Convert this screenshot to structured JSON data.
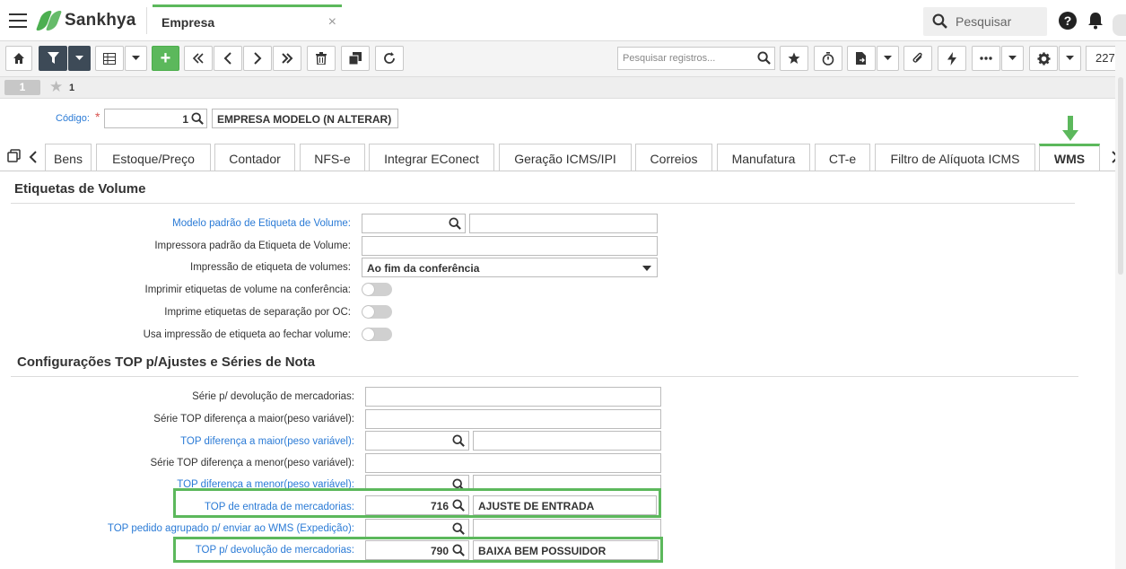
{
  "header": {
    "brand": "Sankhya",
    "app_tab": "Empresa",
    "app_tab_close": "×",
    "search_label": "Pesquisar",
    "help_glyph": "?"
  },
  "toolbar": {
    "search_placeholder": "Pesquisar registros...",
    "record_count": "227",
    "add_glyph": "+"
  },
  "record_nav": {
    "current": "1",
    "favorites_count": "1"
  },
  "record": {
    "codigo_label": "Código:",
    "required_mark": "*",
    "codigo_value": "1",
    "codigo_desc": "EMPRESA MODELO (N ALTERAR)"
  },
  "tabs": [
    {
      "label": "Bens"
    },
    {
      "label": "Estoque/Preço"
    },
    {
      "label": "Contador"
    },
    {
      "label": "NFS-e"
    },
    {
      "label": "Integrar EConect"
    },
    {
      "label": "Geração ICMS/IPI"
    },
    {
      "label": "Correios"
    },
    {
      "label": "Manufatura"
    },
    {
      "label": "CT-e"
    },
    {
      "label": "Filtro de Alíquota ICMS"
    },
    {
      "label": "WMS"
    }
  ],
  "section1": {
    "title": "Etiquetas de Volume",
    "fields": {
      "modelo_etiqueta": "Modelo padrão de Etiqueta de Volume:",
      "impressora": "Impressora padrão da Etiqueta de Volume:",
      "impressao_label": "Impressão de etiqueta de volumes:",
      "impressao_value": "Ao fim da conferência",
      "imprimir_conferencia": "Imprimir etiquetas de volume na conferência:",
      "imprime_separacao": "Imprime etiquetas de separação por OC:",
      "usa_impressao": "Usa impressão de etiqueta ao fechar volume:"
    }
  },
  "section2": {
    "title": "Configurações TOP p/Ajustes e Séries de Nota",
    "fields": {
      "serie_devolucao": "Série p/ devolução de mercadorias:",
      "serie_top_maior": "Série TOP diferença a maior(peso variável):",
      "top_maior": "TOP diferença a maior(peso variável):",
      "serie_top_menor": "Série TOP diferença a menor(peso variável):",
      "top_menor": "TOP diferença a menor(peso variável):",
      "top_entrada": "TOP de entrada de mercadorias:",
      "top_entrada_value": "716",
      "top_entrada_desc": "AJUSTE DE ENTRADA",
      "top_pedido": "TOP pedido agrupado p/ enviar ao WMS (Expedição):",
      "top_devolucao": "TOP p/ devolução de mercadorias:",
      "top_devolucao_value": "790",
      "top_devolucao_desc": "BAIXA BEM POSSUIDOR"
    }
  },
  "colors": {
    "accent_green": "#5cb85c",
    "link_blue": "#2b7bd6",
    "toolbar_dark": "#3d4a57"
  }
}
